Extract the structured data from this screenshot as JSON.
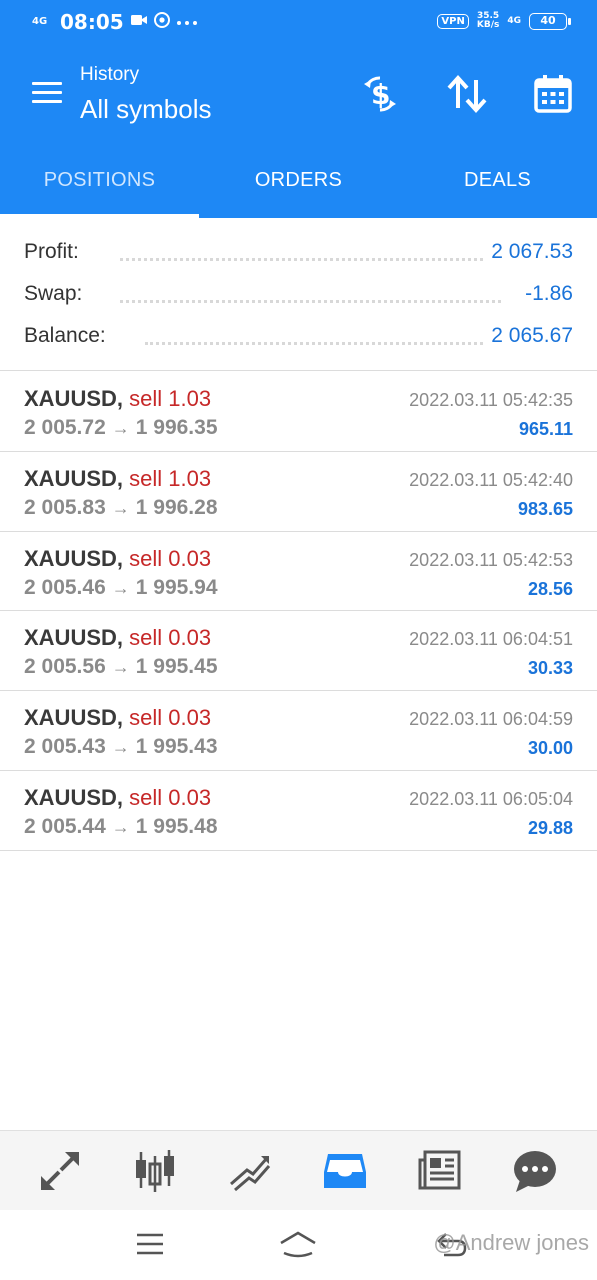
{
  "status_bar": {
    "signal": "4G",
    "time": "08:05",
    "icons": [
      "video-icon",
      "chrome-icon",
      "more-dots-icon"
    ],
    "vpn": "VPN",
    "speed_value": "35.5",
    "speed_unit": "KB/s",
    "network": "4G",
    "battery": "40"
  },
  "toolbar": {
    "subtitle": "History",
    "title": "All symbols",
    "actions": [
      "dollar-exchange-icon",
      "sort-icon",
      "calendar-icon"
    ]
  },
  "tabs": [
    {
      "label": "POSITIONS",
      "active": true
    },
    {
      "label": "ORDERS",
      "active": false
    },
    {
      "label": "DEALS",
      "active": false
    }
  ],
  "summary": {
    "profit_label": "Profit:",
    "profit_value": "2 067.53",
    "swap_label": "Swap:",
    "swap_value": "-1.86",
    "balance_label": "Balance:",
    "balance_value": "2 065.67"
  },
  "deals": [
    {
      "symbol": "XAUUSD,",
      "side": "sell 1.03",
      "open": "2 005.72",
      "arrow": "→",
      "close": "1 996.35",
      "time": "2022.03.11 05:42:35",
      "profit": "965.11"
    },
    {
      "symbol": "XAUUSD,",
      "side": "sell 1.03",
      "open": "2 005.83",
      "arrow": "→",
      "close": "1 996.28",
      "time": "2022.03.11 05:42:40",
      "profit": "983.65"
    },
    {
      "symbol": "XAUUSD,",
      "side": "sell 0.03",
      "open": "2 005.46",
      "arrow": "→",
      "close": "1 995.94",
      "time": "2022.03.11 05:42:53",
      "profit": "28.56"
    },
    {
      "symbol": "XAUUSD,",
      "side": "sell 0.03",
      "open": "2 005.56",
      "arrow": "→",
      "close": "1 995.45",
      "time": "2022.03.11 06:04:51",
      "profit": "30.33"
    },
    {
      "symbol": "XAUUSD,",
      "side": "sell 0.03",
      "open": "2 005.43",
      "arrow": "→",
      "close": "1 995.43",
      "time": "2022.03.11 06:04:59",
      "profit": "30.00"
    },
    {
      "symbol": "XAUUSD,",
      "side": "sell 0.03",
      "open": "2 005.44",
      "arrow": "→",
      "close": "1 995.48",
      "time": "2022.03.11 06:05:04",
      "profit": "29.88"
    }
  ],
  "bottom_nav": [
    "quotes-icon",
    "chart-icon",
    "trade-icon",
    "history-icon",
    "news-icon",
    "chat-icon"
  ],
  "bottom_nav_active": "history-icon",
  "system_nav": [
    "recents-icon",
    "home-icon",
    "back-icon"
  ],
  "watermark": "@Andrew jones",
  "colors": {
    "header_blue": "#1e88f5",
    "value_blue": "#1a73d9",
    "sell_red": "#c62828",
    "muted_gray": "#8a8a8a"
  }
}
